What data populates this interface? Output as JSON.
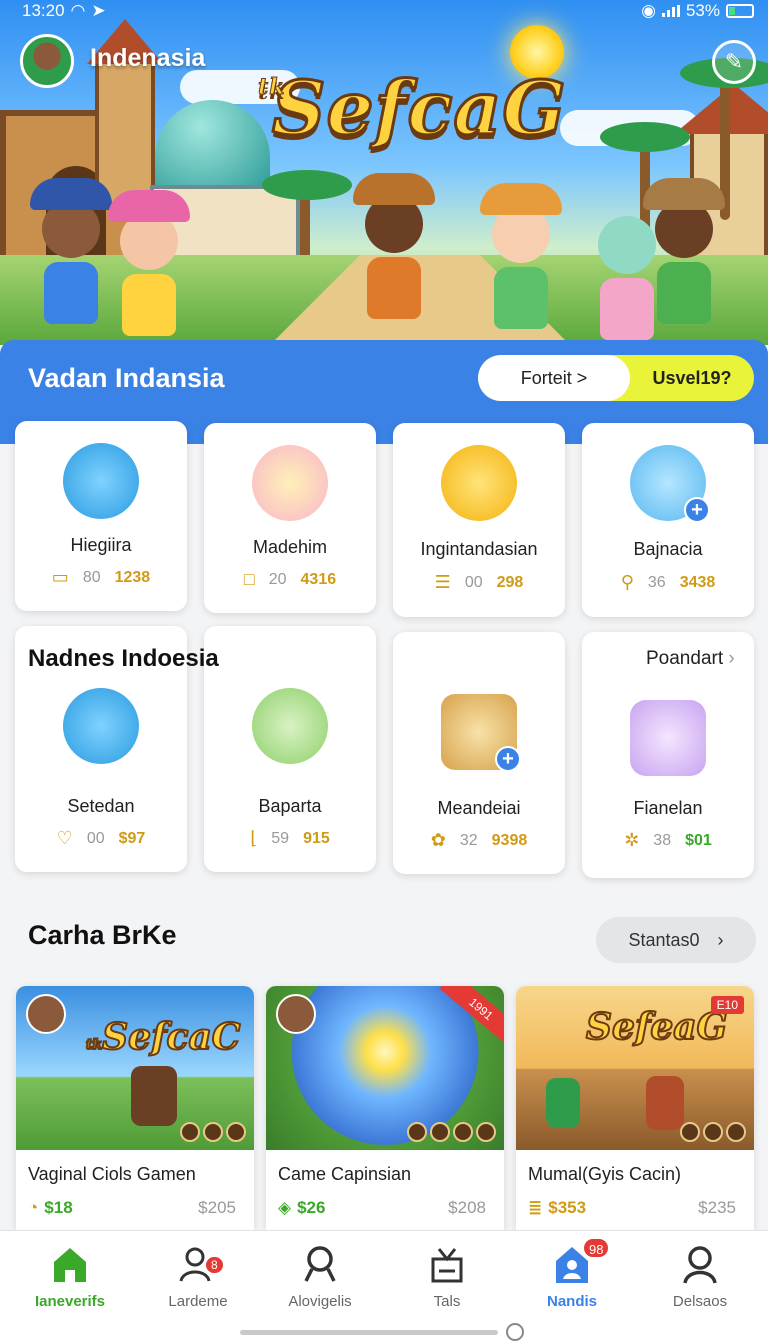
{
  "status_bar": {
    "time": "13:20",
    "battery": "53%"
  },
  "header": {
    "location": "Indenasia",
    "logo_prefix": "tk",
    "logo": "SefcaG"
  },
  "featured": {
    "title": "Vadan Indansia",
    "toggle": {
      "option1": "Forteit >",
      "option2": "Usvel19?"
    }
  },
  "categories": [
    {
      "name": "Hiegiira",
      "a": "80",
      "b": "1238"
    },
    {
      "name": "Madehim",
      "a": "20",
      "b": "4316"
    },
    {
      "name": "Ingintandasian",
      "a": "00",
      "b": "298"
    },
    {
      "name": "Bajnacia",
      "a": "36",
      "b": "3438"
    }
  ],
  "subsection": {
    "title": "Nadnes Indoesia",
    "link": "Poandart"
  },
  "categories2": [
    {
      "name": "Setedan",
      "a": "00",
      "b": "$97"
    },
    {
      "name": "Baparta",
      "a": "59",
      "b": "915"
    },
    {
      "name": "Meandeiai",
      "a": "32",
      "b": "9398"
    },
    {
      "name": "Fianelan",
      "a": "38",
      "b": "$01"
    }
  ],
  "games_section": {
    "title": "Carha BrKe",
    "button": "Stantas0"
  },
  "games": [
    {
      "name": "Vaginal Ciols Gamen",
      "price": "$18",
      "secondary": "$205",
      "logo_prefix": "tk",
      "logo": "SefcaC"
    },
    {
      "name": "Came Capinsian",
      "price": "$26",
      "secondary": "$208",
      "ribbon": "1991"
    },
    {
      "name": "Mumal(Gyis Cacin)",
      "price": "$353",
      "secondary": "$235",
      "logo": "SefeaG",
      "flag": "E10"
    }
  ],
  "nav": [
    {
      "label": "Ianeverifs",
      "icon": "home-icon"
    },
    {
      "label": "Lardeme",
      "icon": "user-group-icon",
      "badge": "8"
    },
    {
      "label": "Alovigelis",
      "icon": "search-icon"
    },
    {
      "label": "Tals",
      "icon": "tv-icon"
    },
    {
      "label": "Nandis",
      "icon": "profile-home-icon",
      "badge": "98"
    },
    {
      "label": "Delsaos",
      "icon": "person-icon"
    }
  ],
  "colors": {
    "accent": "#3b82e6",
    "gold": "#d19a14",
    "green": "#3aa828",
    "badge": "#e53935"
  }
}
